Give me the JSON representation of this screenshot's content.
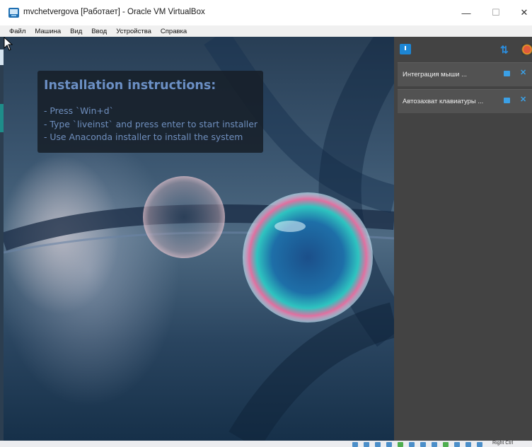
{
  "window": {
    "title": "mvchetvergova [Работает] - Oracle VM VirtualBox",
    "controls": {
      "minimize": "—",
      "maximize": "☐",
      "close": "✕"
    }
  },
  "menu": [
    "Файл",
    "Машина",
    "Вид",
    "Ввод",
    "Устройства",
    "Справка"
  ],
  "guest": {
    "instructions": {
      "title": "Installation instructions:",
      "lines": [
        "- Press `Win+d`",
        "- Type `liveinst` and press enter to start installer",
        "- Use Anaconda installer to install the system"
      ]
    }
  },
  "notifications": [
    {
      "text": "Интеграция мыши ..."
    },
    {
      "text": "Автозахват клавиатуры ..."
    }
  ],
  "icons": {
    "app": "virtualbox-icon",
    "panel_toggle": "notification-center-icon",
    "sort": "sort-icon",
    "pin": "pin-icon",
    "close": "close-icon"
  },
  "statusbar": {
    "host_key": "Right Ctrl"
  },
  "colors": {
    "accent": "#1d86d4",
    "panel_bg": "#434343",
    "notif_bg": "#525252",
    "instructions_text": "#6f8fbe"
  }
}
